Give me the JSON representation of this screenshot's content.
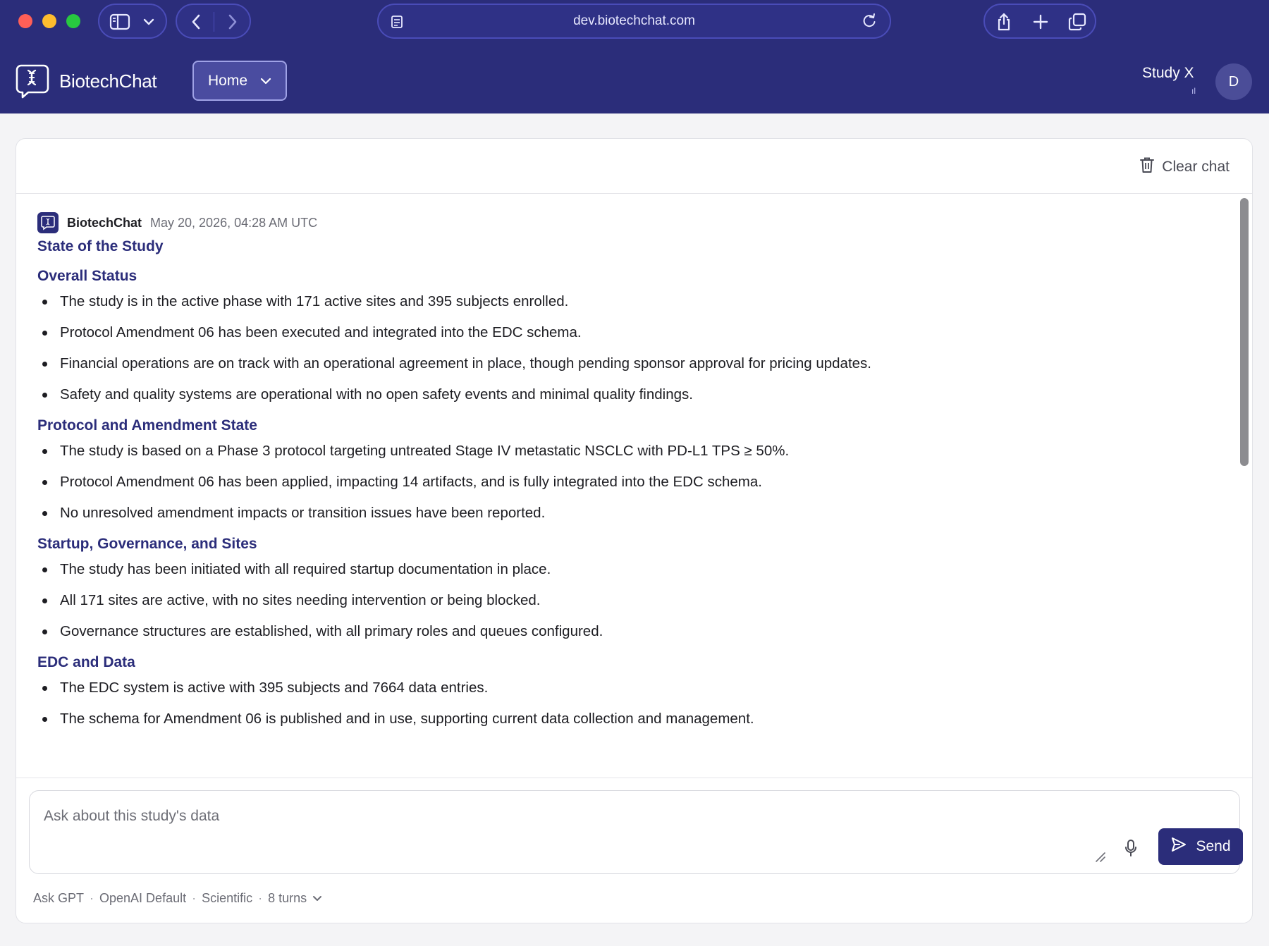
{
  "browser": {
    "url": "dev.biotechchat.com"
  },
  "header": {
    "brand": "BiotechChat",
    "nav_label": "Home",
    "study_label": "Study X",
    "study_signal": "ıl",
    "avatar_initial": "D"
  },
  "toolbar": {
    "clear_label": "Clear chat"
  },
  "message": {
    "sender": "BiotechChat",
    "timestamp": "May 20, 2026, 04:28 AM UTC",
    "title": "State of the Study",
    "sections": [
      {
        "heading": "Overall Status",
        "bullets": [
          "The study is in the active phase with 171 active sites and 395 subjects enrolled.",
          "Protocol Amendment 06 has been executed and integrated into the EDC schema.",
          "Financial operations are on track with an operational agreement in place, though pending sponsor approval for pricing updates.",
          "Safety and quality systems are operational with no open safety events and minimal quality findings."
        ]
      },
      {
        "heading": "Protocol and Amendment State",
        "bullets": [
          "The study is based on a Phase 3 protocol targeting untreated Stage IV metastatic NSCLC with PD-L1 TPS ≥ 50%.",
          "Protocol Amendment 06 has been applied, impacting 14 artifacts, and is fully integrated into the EDC schema.",
          "No unresolved amendment impacts or transition issues have been reported."
        ]
      },
      {
        "heading": "Startup, Governance, and Sites",
        "bullets": [
          "The study has been initiated with all required startup documentation in place.",
          "All 171 sites are active, with no sites needing intervention or being blocked.",
          "Governance structures are established, with all primary roles and queues configured."
        ]
      },
      {
        "heading": "EDC and Data",
        "bullets": [
          "The EDC system is active with 395 subjects and 7664 data entries.",
          "The schema for Amendment 06 is published and in use, supporting current data collection and management."
        ]
      }
    ]
  },
  "composer": {
    "placeholder": "Ask about this study's data",
    "send_label": "Send",
    "meta": {
      "mode": "Ask GPT",
      "model": "OpenAI Default",
      "style": "Scientific",
      "turns": "8 turns"
    }
  },
  "colors": {
    "brand": "#2b2d7a",
    "heading": "#2b2d7a",
    "background": "#f4f4f6"
  },
  "icons": {
    "sidebar": "sidebar-icon",
    "back": "back-arrow-icon",
    "forward": "forward-arrow-icon",
    "reload": "reload-icon",
    "share": "share-icon",
    "new_tab": "plus-icon",
    "tabs": "tabs-overview-icon",
    "clear": "trash-icon",
    "mic": "microphone-icon",
    "send": "send-icon"
  }
}
